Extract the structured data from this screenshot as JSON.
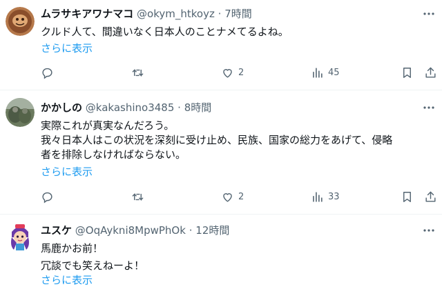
{
  "tweets": [
    {
      "name": "ムラサキアワナマコ",
      "handle": "@okym_htkoyz",
      "sep": "·",
      "time": "7時間",
      "lines": [
        "クルド人て、間違いなく日本人のことナメてるよね。"
      ],
      "show_more": "さらに表示",
      "likes": "2",
      "views": "45"
    },
    {
      "name": "かかしの",
      "handle": "@kakashino3485",
      "sep": "·",
      "time": "8時間",
      "lines": [
        "実際これが真実なんだろう。",
        "我々日本人はこの状況を深刻に受け止め、民族、国家の総力をあげて、侵略",
        "者を排除しなければならない。"
      ],
      "show_more": "さらに表示",
      "likes": "2",
      "views": "33"
    },
    {
      "name": "ユスケ",
      "handle": "@OqAykni8MpwPhOk",
      "sep": "·",
      "time": "12時間",
      "lines": [
        "馬鹿かお前！",
        "冗談でも笑えねーよ！"
      ],
      "show_more": "さらに表示"
    }
  ],
  "icons": {
    "reply": "reply-icon",
    "retweet": "retweet-icon",
    "like": "heart-icon",
    "views": "views-icon",
    "bookmark": "bookmark-icon",
    "share": "share-icon",
    "more": "more-icon"
  },
  "colors": {
    "link": "#1d9bf0",
    "muted": "#536471",
    "text": "#0f1419"
  }
}
